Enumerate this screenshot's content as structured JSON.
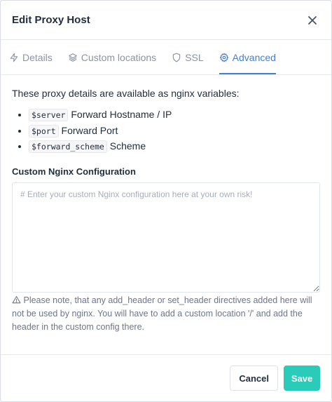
{
  "modal": {
    "title": "Edit Proxy Host",
    "close_icon": "close-icon"
  },
  "tabs": [
    {
      "label": "Details",
      "icon": "bolt-icon",
      "active": false
    },
    {
      "label": "Custom locations",
      "icon": "layers-icon",
      "active": false
    },
    {
      "label": "SSL",
      "icon": "shield-icon",
      "active": false
    },
    {
      "label": "Advanced",
      "icon": "gear-icon",
      "active": true
    }
  ],
  "advanced": {
    "intro": "These proxy details are available as nginx variables:",
    "variables": [
      {
        "code": "$server",
        "description": "Forward Hostname / IP"
      },
      {
        "code": "$port",
        "description": "Forward Port"
      },
      {
        "code": "$forward_scheme",
        "description": "Scheme"
      }
    ],
    "config_label": "Custom Nginx Configuration",
    "config_value": "",
    "config_placeholder": "# Enter your custom Nginx configuration here at your own risk!",
    "note": "Please note, that any add_header or set_header directives added here will not be used by nginx. You will have to add a custom location '/' and add the header in the custom config there."
  },
  "footer": {
    "cancel_label": "Cancel",
    "save_label": "Save"
  },
  "colors": {
    "accent": "#467fcf",
    "save": "#2bcbba"
  }
}
